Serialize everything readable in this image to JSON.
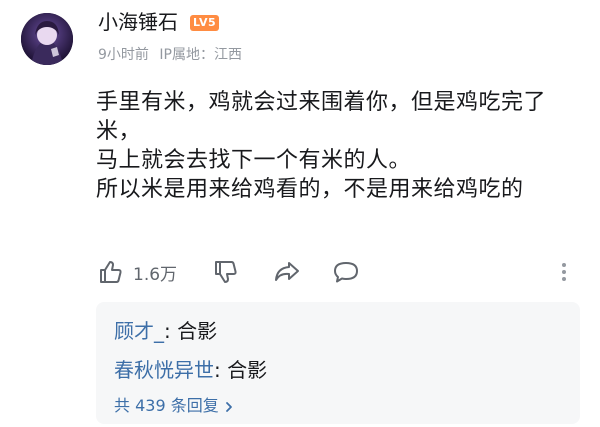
{
  "comment": {
    "author": {
      "name": "小海锤石",
      "level_badge": "LV5",
      "badge_color": "#ff8c42"
    },
    "time": "9小时前",
    "ip_location": "IP属地：江西",
    "lines": [
      "手里有米，鸡就会过来围着你，但是鸡吃完了米，",
      "马上就会去找下一个有米的人。",
      "所以米是用来给鸡看的，不是用来给鸡吃的"
    ],
    "actions": {
      "like_count": "1.6万",
      "like_icon": "thumbs-up-icon",
      "dislike_icon": "thumbs-down-icon",
      "share_icon": "share-icon",
      "comment_icon": "comment-icon",
      "more_icon": "more-vertical-icon"
    }
  },
  "replies": {
    "items": [
      {
        "name": "顾才_",
        "text": ": 合影"
      },
      {
        "name": "春秋恍异世",
        "text": ": 合影"
      }
    ],
    "more_label": "共 439 条回复"
  },
  "colors": {
    "link": "#3d6fa8",
    "text": "#18191c",
    "muted": "#9499a0",
    "reply_bg": "#f6f7f8"
  }
}
